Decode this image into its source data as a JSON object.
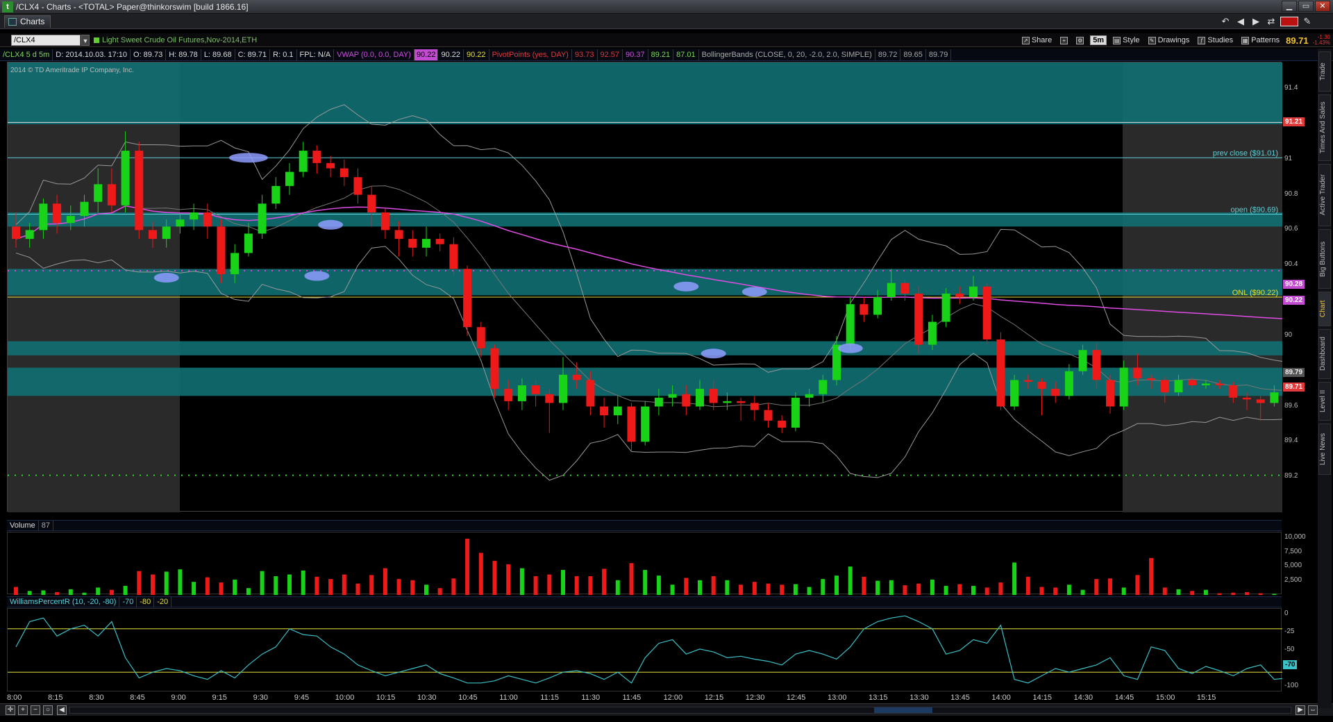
{
  "window": {
    "title": "/CLX4 - Charts - <TOTAL> Paper@thinkorswim [build 1866.16]"
  },
  "tabs": [
    {
      "label": "Charts"
    }
  ],
  "toolbar": {
    "symbol": "/CLX4",
    "description": "Light Sweet Crude Oil Futures,Nov-2014,ETH",
    "share": "Share",
    "aggregation": "5m",
    "style": "Style",
    "drawings": "Drawings",
    "studies": "Studies",
    "patterns": "Patterns",
    "last_price": "89.71",
    "change": "-1.30",
    "change_pct": "-1.43%"
  },
  "infobar": {
    "symbol_period": "/CLX4 5 d 5m",
    "date": "D: 2014.10.03. 17:10",
    "open": "O: 89.73",
    "high": "H: 89.78",
    "low": "L: 89.68",
    "close": "C: 89.71",
    "range": "R: 0.1",
    "fpl": "FPL: N/A",
    "vwap_label": "VWAP (0.0, 0.0, DAY)",
    "vwap_values": [
      "90.22",
      "90.22",
      "90.22"
    ],
    "pivot_label": "PivotPoints (yes, DAY)",
    "pivot_values": [
      "93.73",
      "92.57",
      "90.37",
      "89.21",
      "87.01"
    ],
    "bb_label": "BollingerBands (CLOSE, 0, 20, -2.0, 2.0, SIMPLE)",
    "bb_values": [
      "89.72",
      "89.65",
      "89.79"
    ]
  },
  "watermark": "2014 © TD Ameritrade IP Company, Inc.",
  "price_axis": {
    "ticks": [
      "91.4",
      "91",
      "90.8",
      "90.6",
      "90.4",
      "90",
      "89.6",
      "89.4",
      "89.2"
    ]
  },
  "price_labels": {
    "top": "91.21",
    "mid1": "90.28",
    "mid2": "90.22",
    "bb_upper": "89.79",
    "last": "89.71"
  },
  "annotations": {
    "prev_close": "prev close ($91.01)",
    "open": "open ($90.69)",
    "onl": "ONL ($90.22)"
  },
  "volume": {
    "label": "Volume",
    "value": "87",
    "ticks": [
      "10,000",
      "7,500",
      "5,000",
      "2,500"
    ]
  },
  "williams": {
    "label": "WilliamsPercentR (10, -20, -80)",
    "values": [
      "-70",
      "-80",
      "-20"
    ],
    "ticks": [
      "0",
      "-25",
      "-50",
      "-70",
      "-100"
    ],
    "current": "-70"
  },
  "time_axis": [
    "8:00",
    "8:15",
    "8:30",
    "8:45",
    "9:00",
    "9:15",
    "9:30",
    "9:45",
    "10:00",
    "10:15",
    "10:30",
    "10:45",
    "11:00",
    "11:15",
    "11:30",
    "11:45",
    "12:00",
    "12:15",
    "12:30",
    "12:45",
    "13:00",
    "13:15",
    "13:30",
    "13:45",
    "14:00",
    "14:15",
    "14:30",
    "14:45",
    "15:00",
    "15:15"
  ],
  "right_tabs": [
    "Trade",
    "Times And Sales",
    "Active Trader",
    "Big Buttons",
    "Chart",
    "Dashboard",
    "Level II",
    "Live News"
  ],
  "colors": {
    "up": "#18d318",
    "down": "#ee1a1a",
    "zone": "#0f6f72",
    "vwap": "#e04ce4",
    "pivot_dots": "#e540e5",
    "support_dots": "#22dd22"
  },
  "chart_data": {
    "type": "candlestick",
    "ylim": [
      89.0,
      91.55
    ],
    "candles": [
      [
        90.62,
        90.55,
        90.7,
        90.5
      ],
      [
        90.55,
        90.6,
        90.64,
        90.5
      ],
      [
        90.6,
        90.75,
        90.78,
        90.55
      ],
      [
        90.75,
        90.64,
        90.8,
        90.58
      ],
      [
        90.64,
        90.68,
        90.74,
        90.6
      ],
      [
        90.68,
        90.76,
        90.8,
        90.62
      ],
      [
        90.76,
        90.86,
        90.95,
        90.7
      ],
      [
        90.86,
        90.74,
        90.95,
        90.7
      ],
      [
        90.74,
        91.05,
        91.16,
        90.7
      ],
      [
        91.05,
        90.6,
        91.1,
        90.55
      ],
      [
        90.6,
        90.55,
        90.65,
        90.5
      ],
      [
        90.55,
        90.62,
        90.66,
        90.5
      ],
      [
        90.62,
        90.66,
        90.7,
        90.58
      ],
      [
        90.66,
        90.7,
        90.75,
        90.6
      ],
      [
        90.7,
        90.62,
        90.75,
        90.55
      ],
      [
        90.62,
        90.35,
        90.66,
        90.3
      ],
      [
        90.35,
        90.47,
        90.52,
        90.3
      ],
      [
        90.47,
        90.58,
        90.64,
        90.45
      ],
      [
        90.58,
        90.75,
        90.8,
        90.55
      ],
      [
        90.75,
        90.85,
        90.9,
        90.72
      ],
      [
        90.85,
        90.93,
        90.98,
        90.8
      ],
      [
        90.93,
        91.05,
        91.1,
        90.9
      ],
      [
        91.05,
        90.98,
        91.08,
        90.92
      ],
      [
        90.98,
        90.95,
        91.02,
        90.9
      ],
      [
        90.95,
        90.9,
        91.0,
        90.85
      ],
      [
        90.9,
        90.8,
        90.95,
        90.75
      ],
      [
        90.8,
        90.7,
        90.85,
        90.62
      ],
      [
        90.7,
        90.6,
        90.72,
        90.55
      ],
      [
        90.6,
        90.55,
        90.65,
        90.45
      ],
      [
        90.55,
        90.5,
        90.6,
        90.45
      ],
      [
        90.5,
        90.55,
        90.62,
        90.45
      ],
      [
        90.55,
        90.52,
        90.58,
        90.48
      ],
      [
        90.52,
        90.38,
        90.56,
        90.34
      ],
      [
        90.38,
        90.05,
        90.4,
        90.0
      ],
      [
        90.05,
        89.93,
        90.08,
        89.88
      ],
      [
        89.93,
        89.7,
        89.95,
        89.65
      ],
      [
        89.7,
        89.63,
        89.75,
        89.58
      ],
      [
        89.63,
        89.72,
        89.76,
        89.58
      ],
      [
        89.72,
        89.67,
        89.75,
        89.6
      ],
      [
        89.67,
        89.62,
        89.7,
        89.45
      ],
      [
        89.62,
        89.78,
        89.88,
        89.58
      ],
      [
        89.78,
        89.75,
        89.85,
        89.7
      ],
      [
        89.75,
        89.6,
        89.8,
        89.55
      ],
      [
        89.6,
        89.55,
        89.65,
        89.48
      ],
      [
        89.55,
        89.6,
        89.66,
        89.5
      ],
      [
        89.6,
        89.4,
        89.62,
        89.35
      ],
      [
        89.4,
        89.6,
        89.63,
        89.38
      ],
      [
        89.6,
        89.65,
        89.7,
        89.55
      ],
      [
        89.65,
        89.67,
        89.72,
        89.6
      ],
      [
        89.67,
        89.6,
        89.72,
        89.55
      ],
      [
        89.6,
        89.7,
        89.75,
        89.58
      ],
      [
        89.7,
        89.62,
        89.75,
        89.58
      ],
      [
        89.62,
        89.63,
        89.68,
        89.58
      ],
      [
        89.63,
        89.62,
        89.65,
        89.52
      ],
      [
        89.62,
        89.58,
        89.66,
        89.52
      ],
      [
        89.58,
        89.52,
        89.62,
        89.48
      ],
      [
        89.52,
        89.48,
        89.55,
        89.45
      ],
      [
        89.48,
        89.65,
        89.68,
        89.46
      ],
      [
        89.65,
        89.67,
        89.7,
        89.6
      ],
      [
        89.67,
        89.75,
        89.78,
        89.62
      ],
      [
        89.75,
        89.95,
        90.0,
        89.72
      ],
      [
        89.95,
        90.18,
        90.22,
        89.92
      ],
      [
        90.18,
        90.12,
        90.22,
        90.08
      ],
      [
        90.12,
        90.22,
        90.26,
        90.1
      ],
      [
        90.22,
        90.3,
        90.38,
        90.2
      ],
      [
        90.3,
        90.24,
        90.32,
        90.2
      ],
      [
        90.24,
        89.95,
        90.28,
        89.9
      ],
      [
        89.95,
        90.08,
        90.12,
        89.92
      ],
      [
        90.08,
        90.24,
        90.27,
        90.05
      ],
      [
        90.24,
        90.22,
        90.28,
        90.18
      ],
      [
        90.22,
        90.28,
        90.34,
        90.2
      ],
      [
        90.28,
        89.98,
        90.3,
        89.95
      ],
      [
        89.98,
        89.6,
        90.02,
        89.58
      ],
      [
        89.6,
        89.75,
        89.78,
        89.58
      ],
      [
        89.75,
        89.74,
        89.78,
        89.7
      ],
      [
        89.74,
        89.7,
        89.76,
        89.55
      ],
      [
        89.7,
        89.66,
        89.74,
        89.62
      ],
      [
        89.66,
        89.8,
        89.84,
        89.64
      ],
      [
        89.8,
        89.92,
        89.95,
        89.78
      ],
      [
        89.92,
        89.75,
        89.96,
        89.7
      ],
      [
        89.75,
        89.6,
        89.78,
        89.56
      ],
      [
        89.6,
        89.82,
        89.86,
        89.58
      ],
      [
        89.82,
        89.76,
        89.9,
        89.72
      ],
      [
        89.76,
        89.75,
        89.78,
        89.7
      ],
      [
        89.75,
        89.68,
        89.77,
        89.62
      ],
      [
        89.68,
        89.75,
        89.78,
        89.66
      ],
      [
        89.75,
        89.72,
        89.77,
        89.7
      ],
      [
        89.72,
        89.73,
        89.75,
        89.7
      ],
      [
        89.73,
        89.72,
        89.75,
        89.7
      ],
      [
        89.72,
        89.65,
        89.74,
        89.62
      ],
      [
        89.65,
        89.64,
        89.68,
        89.58
      ],
      [
        89.64,
        89.62,
        89.66,
        89.52
      ],
      [
        89.62,
        89.68,
        89.72,
        89.6
      ],
      [
        89.68,
        89.71,
        89.78,
        89.66
      ]
    ],
    "volume": [
      1400,
      700,
      800,
      500,
      1000,
      400,
      1300,
      900,
      1600,
      4200,
      3600,
      4100,
      4500,
      2300,
      3100,
      2200,
      2700,
      1200,
      4200,
      3300,
      3600,
      4300,
      3200,
      2800,
      3600,
      2000,
      3500,
      4700,
      2800,
      2600,
      1800,
      1200,
      2900,
      9900,
      7400,
      6000,
      5400,
      4700,
      3300,
      3600,
      4400,
      3300,
      3300,
      4600,
      2600,
      5600,
      4400,
      3400,
      1800,
      3000,
      2600,
      3300,
      2600,
      1800,
      2300,
      2000,
      1800,
      1900,
      1400,
      2800,
      3400,
      5000,
      3200,
      2500,
      2600,
      1700,
      2000,
      2700,
      1600,
      1900,
      1600,
      1300,
      2200,
      5700,
      3200,
      1400,
      1300,
      1800,
      900,
      2800,
      2900,
      1300,
      3500,
      6500,
      1300,
      1000,
      700,
      900,
      300,
      400,
      500,
      300,
      200,
      400,
      500
    ],
    "williams": [
      -45,
      -10,
      -5,
      -30,
      -20,
      -15,
      -30,
      -10,
      -60,
      -88,
      -80,
      -75,
      -78,
      -85,
      -90,
      -78,
      -88,
      -70,
      -55,
      -45,
      -20,
      -28,
      -30,
      -45,
      -55,
      -70,
      -78,
      -85,
      -80,
      -75,
      -70,
      -82,
      -88,
      -95,
      -95,
      -92,
      -85,
      -90,
      -95,
      -88,
      -80,
      -78,
      -82,
      -90,
      -80,
      -95,
      -60,
      -40,
      -35,
      -55,
      -48,
      -52,
      -60,
      -58,
      -62,
      -65,
      -70,
      -55,
      -50,
      -55,
      -62,
      -45,
      -20,
      -10,
      -5,
      -2,
      -10,
      -20,
      -55,
      -50,
      -35,
      -40,
      -15,
      -90,
      -95,
      -85,
      -75,
      -80,
      -75,
      -70,
      -60,
      -85,
      -90,
      -45,
      -50,
      -75,
      -82,
      -72,
      -78,
      -85,
      -75,
      -70,
      -90,
      -88,
      -78,
      -60,
      -55
    ]
  }
}
